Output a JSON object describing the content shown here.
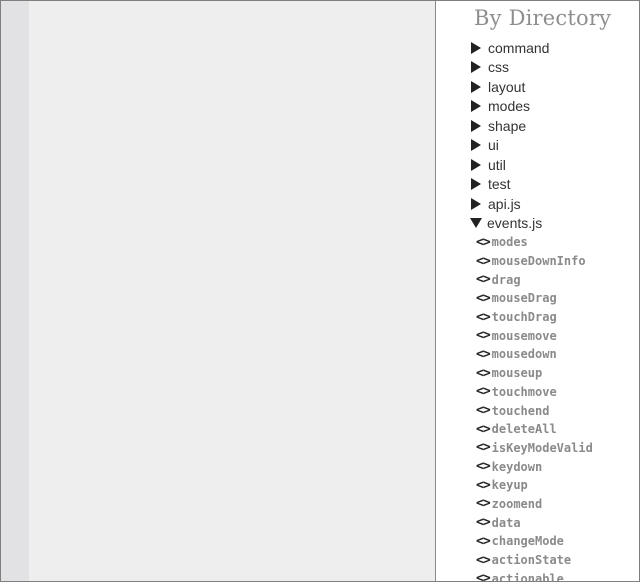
{
  "sidebar": {
    "title": "By Directory",
    "directories": [
      {
        "label": "command",
        "state": "collapsed"
      },
      {
        "label": "css",
        "state": "collapsed"
      },
      {
        "label": "layout",
        "state": "collapsed"
      },
      {
        "label": "modes",
        "state": "collapsed"
      },
      {
        "label": "shape",
        "state": "collapsed"
      },
      {
        "label": "ui",
        "state": "collapsed"
      },
      {
        "label": "util",
        "state": "collapsed"
      },
      {
        "label": "test",
        "state": "collapsed"
      },
      {
        "label": "api.js",
        "state": "collapsed"
      },
      {
        "label": "events.js",
        "state": "expanded"
      }
    ],
    "code_icon_glyph": "<>",
    "functions": [
      {
        "label": "modes"
      },
      {
        "label": "mouseDownInfo"
      },
      {
        "label": "drag"
      },
      {
        "label": "mouseDrag"
      },
      {
        "label": "touchDrag"
      },
      {
        "label": "mousemove"
      },
      {
        "label": "mousedown"
      },
      {
        "label": "mouseup"
      },
      {
        "label": "touchmove"
      },
      {
        "label": "touchend"
      },
      {
        "label": "deleteAll"
      },
      {
        "label": "isKeyModeValid"
      },
      {
        "label": "keydown"
      },
      {
        "label": "keyup"
      },
      {
        "label": "zoomend"
      },
      {
        "label": "data"
      },
      {
        "label": "changeMode"
      },
      {
        "label": "actionState"
      },
      {
        "label": "actionable"
      }
    ]
  },
  "colors": {
    "gutter": "#e2e1e3",
    "main_background": "#efeeef",
    "sidebar_background": "#ffffff",
    "title_text": "#8e8e8e",
    "directory_text": "#333333",
    "function_text": "#8a8a8a",
    "icon": "#222222"
  }
}
